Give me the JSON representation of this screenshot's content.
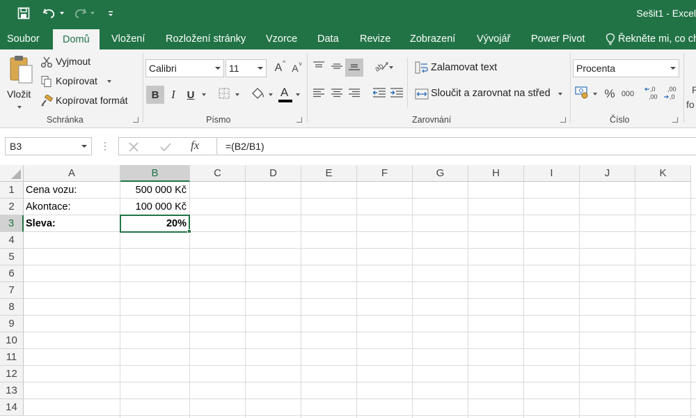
{
  "window": {
    "title": "Sešit1 - Excel"
  },
  "tabs": [
    {
      "label": "Soubor",
      "active": false
    },
    {
      "label": "Domů",
      "active": true
    },
    {
      "label": "Vložení",
      "active": false
    },
    {
      "label": "Rozložení stránky",
      "active": false
    },
    {
      "label": "Vzorce",
      "active": false
    },
    {
      "label": "Data",
      "active": false
    },
    {
      "label": "Revize",
      "active": false
    },
    {
      "label": "Zobrazení",
      "active": false
    },
    {
      "label": "Vývojář",
      "active": false
    },
    {
      "label": "Power Pivot",
      "active": false
    }
  ],
  "tellme": "Řekněte mi, co ch",
  "clipboard": {
    "paste": "Vložit",
    "cut": "Vyjmout",
    "copy": "Kopírovat",
    "format_painter": "Kopírovat formát",
    "label": "Schránka"
  },
  "font": {
    "name": "Calibri",
    "size": "11",
    "label": "Písmo",
    "bold": "B",
    "italic": "I",
    "underline": "U",
    "grow": "A",
    "shrink": "A",
    "font_color_letter": "A"
  },
  "alignment": {
    "wrap": "Zalamovat text",
    "merge": "Sloučit a zarovnat na střed",
    "label": "Zarovnání"
  },
  "number": {
    "format": "Procenta",
    "label": "Číslo",
    "percent": "%",
    "thousands": "000",
    "inc_decimal": "←,0\n,00",
    "dec_decimal": ",00\n→,0"
  },
  "styles_cutoff": {
    "line1": "P",
    "line2": "fo"
  },
  "formula_bar": {
    "name_box": "B3",
    "fx": "fx",
    "formula": "=(B2/B1)"
  },
  "columns": [
    "A",
    "B",
    "C",
    "D",
    "E",
    "F",
    "G",
    "H",
    "I",
    "J",
    "K"
  ],
  "rows": [
    "1",
    "2",
    "3",
    "4",
    "5",
    "6",
    "7",
    "8",
    "9",
    "10",
    "11",
    "12",
    "13",
    "14"
  ],
  "cells": {
    "A1": "Cena vozu:",
    "B1": "500 000 Kč",
    "A2": "Akontace:",
    "B2": "100 000 Kč",
    "A3": "Sleva:",
    "B3": "20%"
  },
  "colors": {
    "accent": "#217346",
    "ribbon_bg": "#f3f3f3",
    "font_color_bar": "#000000"
  }
}
